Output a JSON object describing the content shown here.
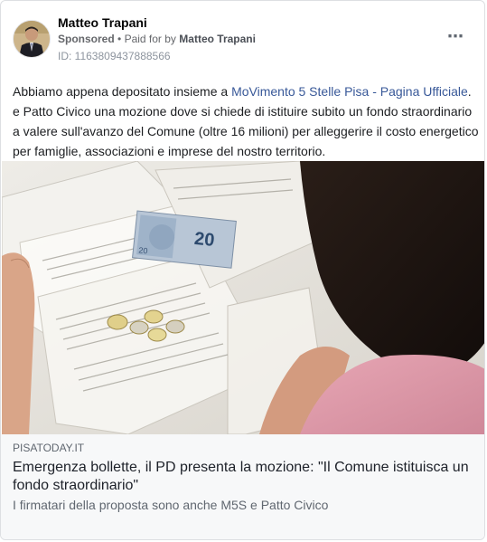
{
  "post": {
    "author": "Matteo Trapani",
    "sponsored": "Sponsored",
    "separator": "•",
    "paid_for_by": "Paid for by",
    "payer": "Matteo Trapani",
    "ad_id": "ID: 1163809437888566",
    "more_icon": "⋯",
    "text_before": "Abbiamo appena depositato insieme a ",
    "mention": "MoVimento 5 Stelle Pisa - Pagina Ufficiale",
    "text_after": ". e Patto Civico una mozione dove si chiede di istituire subito un fondo straordinario a valere sull'avanzo del Comune (oltre 16 milioni) per alleggerire il costo energetico per famiglie, associazioni e imprese del nostro territorio."
  },
  "image": {
    "banknote_value": "20"
  },
  "link_preview": {
    "domain": "PISATODAY.IT",
    "title": "Emergenza bollette, il PD presenta la mozione: \"Il Comune istituisca un fondo straordinario\"",
    "description": "I firmatari della proposta sono anche M5S e Patto Civico"
  },
  "colors": {
    "mention": "#385898",
    "secondary_text": "#65676b",
    "link_bg": "#f7f8f9"
  }
}
